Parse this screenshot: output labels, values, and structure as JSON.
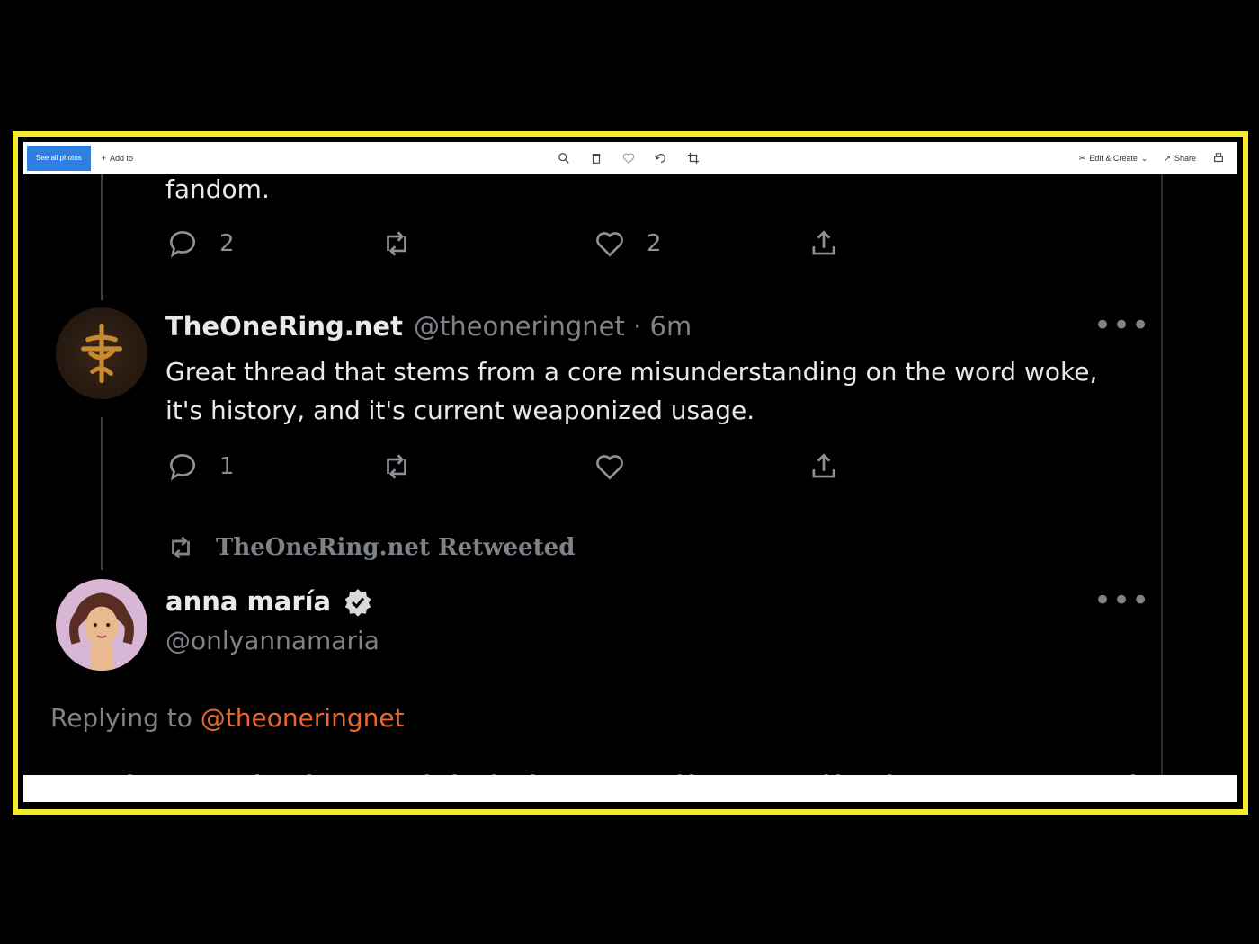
{
  "viewer": {
    "see_all_photos": "See all photos",
    "add_to": "Add to",
    "edit_create": "Edit & Create",
    "share": "Share"
  },
  "thread": {
    "prev_tweet": {
      "text_tail": "fandom.",
      "reply_count": "2",
      "like_count": "2"
    },
    "tweet": {
      "name": "TheOneRing.net",
      "handle_time": "@theoneringnet · 6m",
      "text": "Great thread that stems from a core misunderstanding on the word woke, it's history, and it's current weaponized usage.",
      "reply_count": "1",
      "more": "•••"
    },
    "retweet": {
      "label": "TheOneRing.net Retweeted",
      "name": "anna maría",
      "handle": "@onlyannamaria",
      "more": "•••",
      "replying_prefix": "Replying to",
      "replying_mention": "@theoneringnet",
      "cut_text": "Yeah. And also I think it's really, really important that we"
    }
  },
  "colors": {
    "accent_mention": "#e8682c",
    "frame": "#f4ec2c",
    "verified": "#d9d9d9"
  },
  "icons": [
    "reply-icon",
    "retweet-icon",
    "like-icon",
    "share-icon",
    "verified-badge-icon",
    "more-icon"
  ]
}
